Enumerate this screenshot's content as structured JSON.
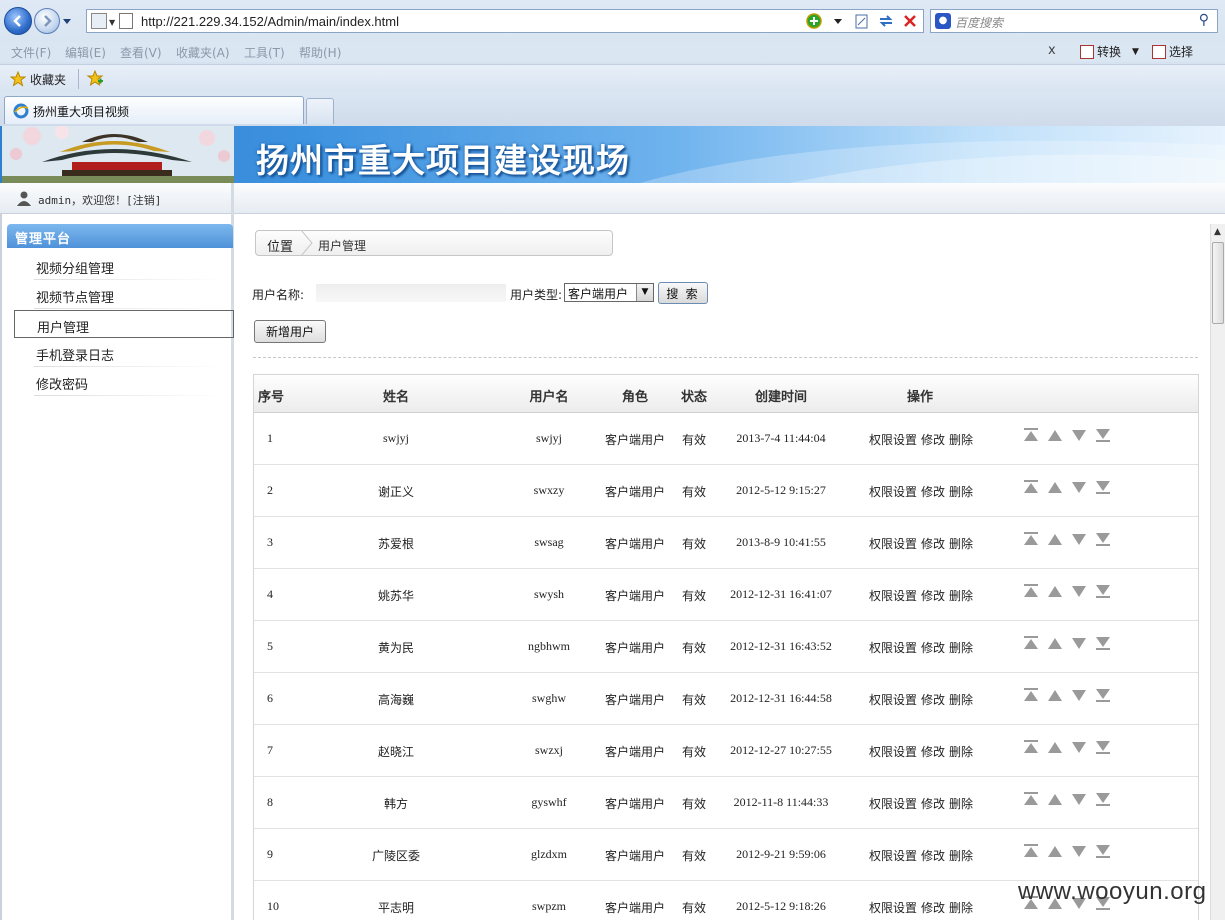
{
  "browser": {
    "url": "http://221.229.34.152/Admin/main/index.html",
    "search_placeholder": "百度搜索",
    "menu": [
      "文件(F)",
      "编辑(E)",
      "查看(V)",
      "收藏夹(A)",
      "工具(T)",
      "帮助(H)"
    ],
    "close_label": "x",
    "convert_label": "转换",
    "select_label": "选择",
    "favorites_label": "收藏夹",
    "tab_title": "扬州重大项目视频"
  },
  "header": {
    "banner_title": "扬州市重大项目建设现场",
    "user_greeting": "admin，欢迎您！[注销]"
  },
  "sidebar": {
    "title": "管理平台",
    "items": [
      {
        "label": "视频分组管理"
      },
      {
        "label": "视频节点管理"
      },
      {
        "label": "用户管理"
      },
      {
        "label": "手机登录日志"
      },
      {
        "label": "修改密码"
      }
    ],
    "active_index": 2
  },
  "breadcrumb": {
    "position_label": "位置",
    "page": "用户管理"
  },
  "search_form": {
    "username_label": "用户名称:",
    "username_value": "",
    "usertype_label": "用户类型:",
    "usertype_value": "客户端用户",
    "search_button": "搜 索",
    "add_button": "新增用户"
  },
  "table": {
    "headers": [
      "序号",
      "姓名",
      "用户名",
      "角色",
      "状态",
      "创建时间",
      "操作"
    ],
    "op_labels": [
      "权限设置",
      "修改",
      "删除"
    ],
    "rows": [
      {
        "no": "1",
        "name": "swjyj",
        "username": "swjyj",
        "role": "客户端用户",
        "status": "有效",
        "created": "2013-7-4 11:44:04"
      },
      {
        "no": "2",
        "name": "谢正义",
        "username": "swxzy",
        "role": "客户端用户",
        "status": "有效",
        "created": "2012-5-12 9:15:27"
      },
      {
        "no": "3",
        "name": "苏爱根",
        "username": "swsag",
        "role": "客户端用户",
        "status": "有效",
        "created": "2013-8-9 10:41:55"
      },
      {
        "no": "4",
        "name": "姚苏华",
        "username": "swysh",
        "role": "客户端用户",
        "status": "有效",
        "created": "2012-12-31 16:41:07"
      },
      {
        "no": "5",
        "name": "黄为民",
        "username": "ngbhwm",
        "role": "客户端用户",
        "status": "有效",
        "created": "2012-12-31 16:43:52"
      },
      {
        "no": "6",
        "name": "高海巍",
        "username": "swghw",
        "role": "客户端用户",
        "status": "有效",
        "created": "2012-12-31 16:44:58"
      },
      {
        "no": "7",
        "name": "赵晓江",
        "username": "swzxj",
        "role": "客户端用户",
        "status": "有效",
        "created": "2012-12-27 10:27:55"
      },
      {
        "no": "8",
        "name": "韩方",
        "username": "gyswhf",
        "role": "客户端用户",
        "status": "有效",
        "created": "2012-11-8 11:44:33"
      },
      {
        "no": "9",
        "name": "广陵区委",
        "username": "glzdxm",
        "role": "客户端用户",
        "status": "有效",
        "created": "2012-9-21 9:59:06"
      },
      {
        "no": "10",
        "name": "平志明",
        "username": "swpzm",
        "role": "客户端用户",
        "status": "有效",
        "created": "2012-5-12 9:18:26"
      }
    ]
  },
  "watermark": "www.wooyun.org",
  "colors": {
    "sidebar_header": "#4f92d9",
    "banner_start": "#2f7fd0",
    "banner_end": "#e7f3fd",
    "sort_icon": "#9a9a9a"
  }
}
